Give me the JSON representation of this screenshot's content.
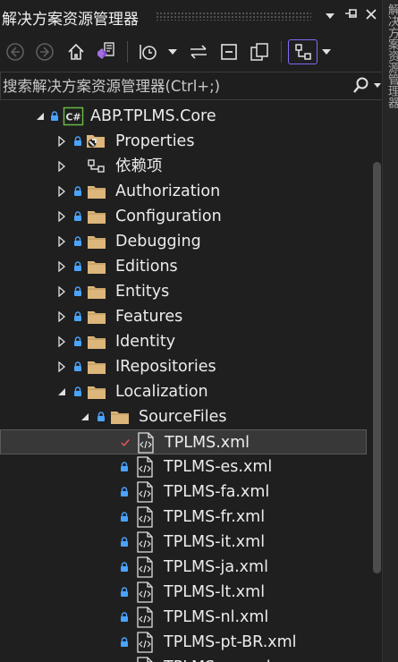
{
  "panel": {
    "title": "解决方案资源管理器"
  },
  "search": {
    "placeholder": "搜索解决方案资源管理器(Ctrl+;)"
  },
  "side_tab": {
    "label": "解决方案资源管理器"
  },
  "tree": [
    {
      "label": "ABP.TPLMS.Core",
      "icon": "csharp-project-icon",
      "expander": "expanded",
      "locked": true,
      "level": 0
    },
    {
      "label": "Properties",
      "icon": "properties-folder-icon",
      "expander": "collapsed",
      "locked": true,
      "level": 1
    },
    {
      "label": "依赖项",
      "icon": "dependencies-icon",
      "expander": "collapsed",
      "locked": false,
      "level": 1
    },
    {
      "label": "Authorization",
      "icon": "folder-icon",
      "expander": "collapsed",
      "locked": true,
      "level": 1
    },
    {
      "label": "Configuration",
      "icon": "folder-icon",
      "expander": "collapsed",
      "locked": true,
      "level": 1
    },
    {
      "label": "Debugging",
      "icon": "folder-icon",
      "expander": "collapsed",
      "locked": true,
      "level": 1
    },
    {
      "label": "Editions",
      "icon": "folder-icon",
      "expander": "collapsed",
      "locked": true,
      "level": 1
    },
    {
      "label": "Entitys",
      "icon": "folder-icon",
      "expander": "collapsed",
      "locked": true,
      "level": 1
    },
    {
      "label": "Features",
      "icon": "folder-icon",
      "expander": "collapsed",
      "locked": true,
      "level": 1
    },
    {
      "label": "Identity",
      "icon": "folder-icon",
      "expander": "collapsed",
      "locked": true,
      "level": 1
    },
    {
      "label": "IRepositories",
      "icon": "folder-icon",
      "expander": "collapsed",
      "locked": true,
      "level": 1
    },
    {
      "label": "Localization",
      "icon": "folder-icon",
      "expander": "expanded",
      "locked": true,
      "level": 1
    },
    {
      "label": "SourceFiles",
      "icon": "folder-icon",
      "expander": "expanded",
      "locked": true,
      "level": 2
    },
    {
      "label": "TPLMS.xml",
      "icon": "xml-file-icon",
      "expander": "none",
      "locked": false,
      "checked": true,
      "selected": true,
      "level": 3
    },
    {
      "label": "TPLMS-es.xml",
      "icon": "xml-file-icon",
      "expander": "none",
      "locked": true,
      "level": 3
    },
    {
      "label": "TPLMS-fa.xml",
      "icon": "xml-file-icon",
      "expander": "none",
      "locked": true,
      "level": 3
    },
    {
      "label": "TPLMS-fr.xml",
      "icon": "xml-file-icon",
      "expander": "none",
      "locked": true,
      "level": 3
    },
    {
      "label": "TPLMS-it.xml",
      "icon": "xml-file-icon",
      "expander": "none",
      "locked": true,
      "level": 3
    },
    {
      "label": "TPLMS-ja.xml",
      "icon": "xml-file-icon",
      "expander": "none",
      "locked": true,
      "level": 3
    },
    {
      "label": "TPLMS-lt.xml",
      "icon": "xml-file-icon",
      "expander": "none",
      "locked": true,
      "level": 3
    },
    {
      "label": "TPLMS-nl.xml",
      "icon": "xml-file-icon",
      "expander": "none",
      "locked": true,
      "level": 3
    },
    {
      "label": "TPLMS-pt-BR.xml",
      "icon": "xml-file-icon",
      "expander": "none",
      "locked": true,
      "level": 3
    },
    {
      "label": "TPLMS-ru.xml",
      "icon": "xml-file-icon",
      "expander": "none",
      "locked": true,
      "level": 3
    }
  ],
  "colors": {
    "background": "#1f1f1f",
    "folder": "#dcb67a",
    "lock": "#4aa3ff",
    "check": "#e0565b",
    "csharp": "#68b845",
    "accent": "#7b6cf6"
  }
}
